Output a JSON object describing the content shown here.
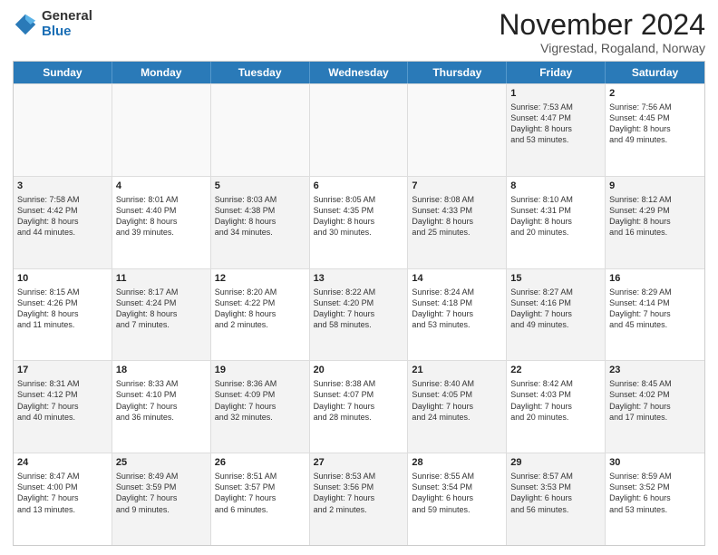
{
  "logo": {
    "general": "General",
    "blue": "Blue"
  },
  "title": "November 2024",
  "subtitle": "Vigrestad, Rogaland, Norway",
  "header_days": [
    "Sunday",
    "Monday",
    "Tuesday",
    "Wednesday",
    "Thursday",
    "Friday",
    "Saturday"
  ],
  "rows": [
    [
      {
        "day": "",
        "text": "",
        "empty": true
      },
      {
        "day": "",
        "text": "",
        "empty": true
      },
      {
        "day": "",
        "text": "",
        "empty": true
      },
      {
        "day": "",
        "text": "",
        "empty": true
      },
      {
        "day": "",
        "text": "",
        "empty": true
      },
      {
        "day": "1",
        "text": "Sunrise: 7:53 AM\nSunset: 4:47 PM\nDaylight: 8 hours\nand 53 minutes.",
        "empty": false,
        "shaded": true
      },
      {
        "day": "2",
        "text": "Sunrise: 7:56 AM\nSunset: 4:45 PM\nDaylight: 8 hours\nand 49 minutes.",
        "empty": false,
        "shaded": false
      }
    ],
    [
      {
        "day": "3",
        "text": "Sunrise: 7:58 AM\nSunset: 4:42 PM\nDaylight: 8 hours\nand 44 minutes.",
        "empty": false,
        "shaded": true
      },
      {
        "day": "4",
        "text": "Sunrise: 8:01 AM\nSunset: 4:40 PM\nDaylight: 8 hours\nand 39 minutes.",
        "empty": false,
        "shaded": false
      },
      {
        "day": "5",
        "text": "Sunrise: 8:03 AM\nSunset: 4:38 PM\nDaylight: 8 hours\nand 34 minutes.",
        "empty": false,
        "shaded": true
      },
      {
        "day": "6",
        "text": "Sunrise: 8:05 AM\nSunset: 4:35 PM\nDaylight: 8 hours\nand 30 minutes.",
        "empty": false,
        "shaded": false
      },
      {
        "day": "7",
        "text": "Sunrise: 8:08 AM\nSunset: 4:33 PM\nDaylight: 8 hours\nand 25 minutes.",
        "empty": false,
        "shaded": true
      },
      {
        "day": "8",
        "text": "Sunrise: 8:10 AM\nSunset: 4:31 PM\nDaylight: 8 hours\nand 20 minutes.",
        "empty": false,
        "shaded": false
      },
      {
        "day": "9",
        "text": "Sunrise: 8:12 AM\nSunset: 4:29 PM\nDaylight: 8 hours\nand 16 minutes.",
        "empty": false,
        "shaded": true
      }
    ],
    [
      {
        "day": "10",
        "text": "Sunrise: 8:15 AM\nSunset: 4:26 PM\nDaylight: 8 hours\nand 11 minutes.",
        "empty": false,
        "shaded": false
      },
      {
        "day": "11",
        "text": "Sunrise: 8:17 AM\nSunset: 4:24 PM\nDaylight: 8 hours\nand 7 minutes.",
        "empty": false,
        "shaded": true
      },
      {
        "day": "12",
        "text": "Sunrise: 8:20 AM\nSunset: 4:22 PM\nDaylight: 8 hours\nand 2 minutes.",
        "empty": false,
        "shaded": false
      },
      {
        "day": "13",
        "text": "Sunrise: 8:22 AM\nSunset: 4:20 PM\nDaylight: 7 hours\nand 58 minutes.",
        "empty": false,
        "shaded": true
      },
      {
        "day": "14",
        "text": "Sunrise: 8:24 AM\nSunset: 4:18 PM\nDaylight: 7 hours\nand 53 minutes.",
        "empty": false,
        "shaded": false
      },
      {
        "day": "15",
        "text": "Sunrise: 8:27 AM\nSunset: 4:16 PM\nDaylight: 7 hours\nand 49 minutes.",
        "empty": false,
        "shaded": true
      },
      {
        "day": "16",
        "text": "Sunrise: 8:29 AM\nSunset: 4:14 PM\nDaylight: 7 hours\nand 45 minutes.",
        "empty": false,
        "shaded": false
      }
    ],
    [
      {
        "day": "17",
        "text": "Sunrise: 8:31 AM\nSunset: 4:12 PM\nDaylight: 7 hours\nand 40 minutes.",
        "empty": false,
        "shaded": true
      },
      {
        "day": "18",
        "text": "Sunrise: 8:33 AM\nSunset: 4:10 PM\nDaylight: 7 hours\nand 36 minutes.",
        "empty": false,
        "shaded": false
      },
      {
        "day": "19",
        "text": "Sunrise: 8:36 AM\nSunset: 4:09 PM\nDaylight: 7 hours\nand 32 minutes.",
        "empty": false,
        "shaded": true
      },
      {
        "day": "20",
        "text": "Sunrise: 8:38 AM\nSunset: 4:07 PM\nDaylight: 7 hours\nand 28 minutes.",
        "empty": false,
        "shaded": false
      },
      {
        "day": "21",
        "text": "Sunrise: 8:40 AM\nSunset: 4:05 PM\nDaylight: 7 hours\nand 24 minutes.",
        "empty": false,
        "shaded": true
      },
      {
        "day": "22",
        "text": "Sunrise: 8:42 AM\nSunset: 4:03 PM\nDaylight: 7 hours\nand 20 minutes.",
        "empty": false,
        "shaded": false
      },
      {
        "day": "23",
        "text": "Sunrise: 8:45 AM\nSunset: 4:02 PM\nDaylight: 7 hours\nand 17 minutes.",
        "empty": false,
        "shaded": true
      }
    ],
    [
      {
        "day": "24",
        "text": "Sunrise: 8:47 AM\nSunset: 4:00 PM\nDaylight: 7 hours\nand 13 minutes.",
        "empty": false,
        "shaded": false
      },
      {
        "day": "25",
        "text": "Sunrise: 8:49 AM\nSunset: 3:59 PM\nDaylight: 7 hours\nand 9 minutes.",
        "empty": false,
        "shaded": true
      },
      {
        "day": "26",
        "text": "Sunrise: 8:51 AM\nSunset: 3:57 PM\nDaylight: 7 hours\nand 6 minutes.",
        "empty": false,
        "shaded": false
      },
      {
        "day": "27",
        "text": "Sunrise: 8:53 AM\nSunset: 3:56 PM\nDaylight: 7 hours\nand 2 minutes.",
        "empty": false,
        "shaded": true
      },
      {
        "day": "28",
        "text": "Sunrise: 8:55 AM\nSunset: 3:54 PM\nDaylight: 6 hours\nand 59 minutes.",
        "empty": false,
        "shaded": false
      },
      {
        "day": "29",
        "text": "Sunrise: 8:57 AM\nSunset: 3:53 PM\nDaylight: 6 hours\nand 56 minutes.",
        "empty": false,
        "shaded": true
      },
      {
        "day": "30",
        "text": "Sunrise: 8:59 AM\nSunset: 3:52 PM\nDaylight: 6 hours\nand 53 minutes.",
        "empty": false,
        "shaded": false
      }
    ]
  ]
}
